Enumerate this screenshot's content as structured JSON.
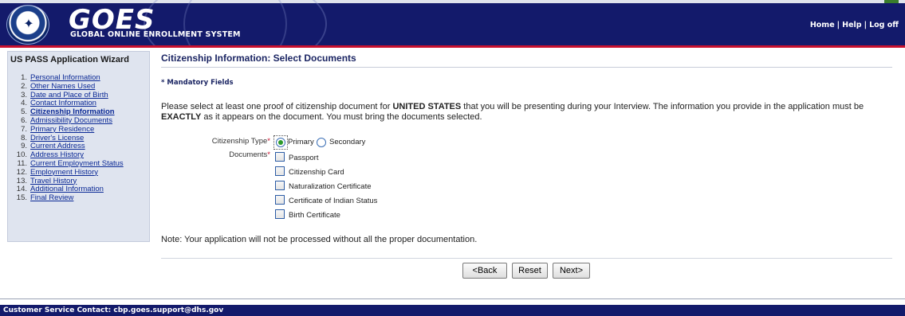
{
  "header": {
    "logo_text": "GOES",
    "logo_subtitle": "GLOBAL ONLINE ENROLLMENT SYSTEM",
    "seal_text": "U.S. DEPARTMENT OF HOMELAND SECURITY",
    "nav": {
      "home": "Home",
      "help": "Help",
      "logoff": "Log off",
      "separator": "|"
    },
    "colors": {
      "navy": "#131a6b",
      "accent_red": "#c8102e"
    }
  },
  "sidebar": {
    "title": "US PASS Application Wizard",
    "items": [
      {
        "num": "1.",
        "label": "Personal Information"
      },
      {
        "num": "2.",
        "label": "Other Names Used"
      },
      {
        "num": "3.",
        "label": "Date and Place of Birth"
      },
      {
        "num": "4.",
        "label": "Contact Information"
      },
      {
        "num": "5.",
        "label": "Citizenship Information"
      },
      {
        "num": "6.",
        "label": "Admissibility Documents"
      },
      {
        "num": "7.",
        "label": "Primary Residence"
      },
      {
        "num": "8.",
        "label": "Driver's License"
      },
      {
        "num": "9.",
        "label": "Current Address"
      },
      {
        "num": "10.",
        "label": "Address History"
      },
      {
        "num": "11.",
        "label": "Current Employment Status"
      },
      {
        "num": "12.",
        "label": "Employment History"
      },
      {
        "num": "13.",
        "label": "Travel History"
      },
      {
        "num": "14.",
        "label": "Additional Information"
      },
      {
        "num": "15.",
        "label": "Final Review"
      }
    ],
    "current_index": 4
  },
  "main": {
    "title": "Citizenship Information: Select Documents",
    "mandatory_note": "* Mandatory Fields",
    "instructions": {
      "part1": "Please select at least one proof of citizenship document for ",
      "country": "UNITED STATES",
      "part2": " that you will be presenting during your Interview. The information you provide in the application must be ",
      "exactly": "EXACTLY",
      "part3": " as it appears on the document. You must bring the documents selected."
    },
    "citizenship_type": {
      "label": "Citizenship Type",
      "required_mark": "*",
      "options": [
        "Primary",
        "Secondary"
      ],
      "selected": "Primary"
    },
    "documents": {
      "label": "Documents",
      "required_mark": "*",
      "items": [
        {
          "label": "Passport",
          "checked": false
        },
        {
          "label": "Citizenship Card",
          "checked": false
        },
        {
          "label": "Naturalization Certificate",
          "checked": false
        },
        {
          "label": "Certificate of Indian Status",
          "checked": false
        },
        {
          "label": "Birth Certificate",
          "checked": false
        }
      ]
    },
    "note": "Note: Your application will not be processed without all the proper documentation."
  },
  "buttons": {
    "back": "<Back",
    "reset": "Reset",
    "next": "Next>"
  },
  "footer": {
    "text": "Customer Service Contact: cbp.goes.support@dhs.gov"
  }
}
